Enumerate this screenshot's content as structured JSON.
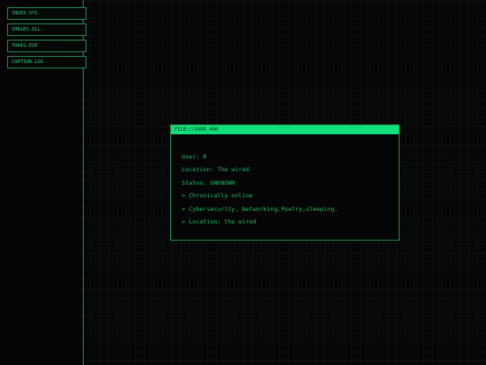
{
  "sidebar": {
    "items": [
      {
        "label": "INDEX.SYS"
      },
      {
        "label": "IMAGES.DLL"
      },
      {
        "label": "TRAKS.EXE"
      },
      {
        "label": "CAPTION.LOG"
      }
    ]
  },
  "window": {
    "title": "FILE://USER_400",
    "lines": [
      "User: R",
      "Location: The wired",
      "Status: UNKNOWN",
      "> Chronically online",
      "> Cybersecurity, Networking,Poetry,sleeping,",
      "> Location: the wired"
    ]
  },
  "colors": {
    "accent": "#0fe07a",
    "text": "#2bd87a",
    "border": "#1f8a4f",
    "background": "#050605"
  }
}
